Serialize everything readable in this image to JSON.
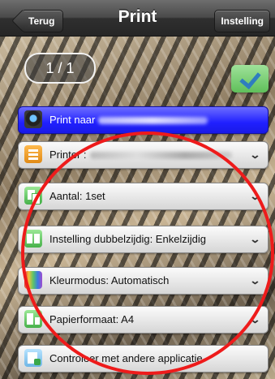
{
  "nav": {
    "back_label": "Terug",
    "title": "Print",
    "settings_label": "Instelling"
  },
  "preview": {
    "page_indicator": "1 / 1"
  },
  "options": [
    {
      "label": "Print naar",
      "icon": "print-destination-icon",
      "redacted": true,
      "chevron": false
    },
    {
      "label": "Printer :",
      "icon": "printer-icon",
      "redacted": true,
      "chevron": true
    },
    {
      "label": "Aantal: 1set",
      "icon": "copies-icon",
      "chevron": true
    },
    {
      "label": "Instelling dubbelzijdig: Enkelzijdig",
      "icon": "duplex-icon",
      "chevron": true
    },
    {
      "label": "Kleurmodus: Automatisch",
      "icon": "color-mode-icon",
      "chevron": true
    },
    {
      "label": "Papierformaat: A4",
      "icon": "paper-size-icon",
      "chevron": true
    },
    {
      "label": "Controleer met andere applicatie",
      "icon": "other-app-icon",
      "chevron": false
    }
  ],
  "colors": {
    "selected_row": "#2020ff",
    "annotation": "#ee1b1b"
  }
}
